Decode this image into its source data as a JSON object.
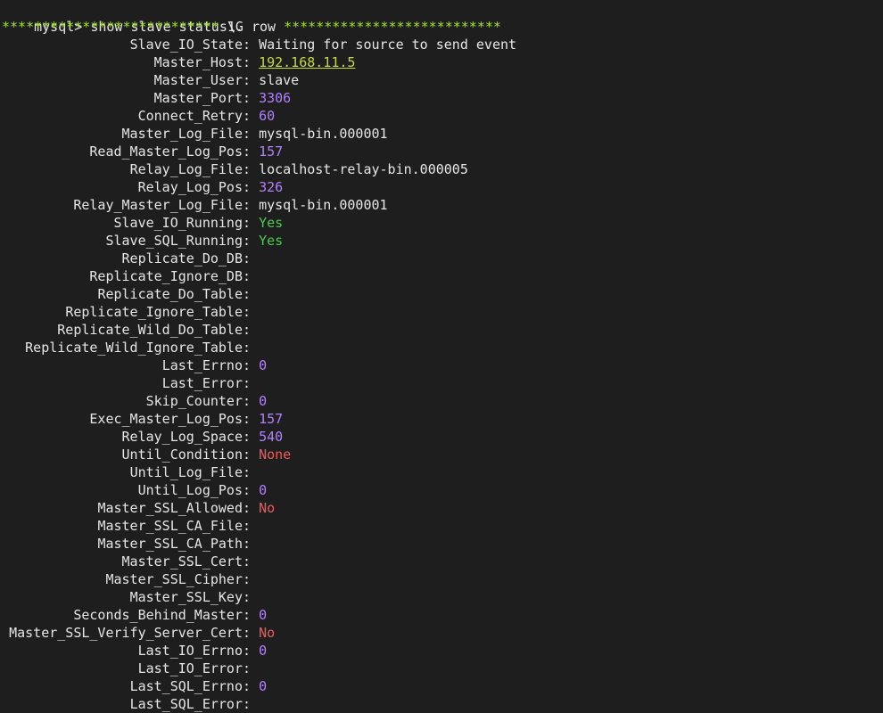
{
  "prompt": {
    "text": "mysql> show slave status\\G"
  },
  "row_header": {
    "stars_left": "***************************",
    "label": " 1. row ",
    "stars_right": "***************************"
  },
  "colors": {
    "number": "#b180ff",
    "ip": "#c5d83a",
    "yes": "#4ec94e",
    "no_none": "#f15a5a",
    "stars": "#a6e22e"
  },
  "fields": [
    {
      "key": "Slave_IO_State",
      "value": "Waiting for source to send event",
      "type": "text"
    },
    {
      "key": "Master_Host",
      "value": "192.168.11.5",
      "type": "ip"
    },
    {
      "key": "Master_User",
      "value": "slave",
      "type": "text"
    },
    {
      "key": "Master_Port",
      "value": "3306",
      "type": "num"
    },
    {
      "key": "Connect_Retry",
      "value": "60",
      "type": "num"
    },
    {
      "key": "Master_Log_File",
      "value": "mysql-bin.000001",
      "type": "text"
    },
    {
      "key": "Read_Master_Log_Pos",
      "value": "157",
      "type": "num"
    },
    {
      "key": "Relay_Log_File",
      "value": "localhost-relay-bin.000005",
      "type": "text"
    },
    {
      "key": "Relay_Log_Pos",
      "value": "326",
      "type": "num"
    },
    {
      "key": "Relay_Master_Log_File",
      "value": "mysql-bin.000001",
      "type": "text"
    },
    {
      "key": "Slave_IO_Running",
      "value": "Yes",
      "type": "yes"
    },
    {
      "key": "Slave_SQL_Running",
      "value": "Yes",
      "type": "yes"
    },
    {
      "key": "Replicate_Do_DB",
      "value": "",
      "type": "text"
    },
    {
      "key": "Replicate_Ignore_DB",
      "value": "",
      "type": "text"
    },
    {
      "key": "Replicate_Do_Table",
      "value": "",
      "type": "text"
    },
    {
      "key": "Replicate_Ignore_Table",
      "value": "",
      "type": "text"
    },
    {
      "key": "Replicate_Wild_Do_Table",
      "value": "",
      "type": "text"
    },
    {
      "key": "Replicate_Wild_Ignore_Table",
      "value": "",
      "type": "text"
    },
    {
      "key": "Last_Errno",
      "value": "0",
      "type": "num"
    },
    {
      "key": "Last_Error",
      "value": "",
      "type": "text"
    },
    {
      "key": "Skip_Counter",
      "value": "0",
      "type": "num"
    },
    {
      "key": "Exec_Master_Log_Pos",
      "value": "157",
      "type": "num"
    },
    {
      "key": "Relay_Log_Space",
      "value": "540",
      "type": "num"
    },
    {
      "key": "Until_Condition",
      "value": "None",
      "type": "red"
    },
    {
      "key": "Until_Log_File",
      "value": "",
      "type": "text"
    },
    {
      "key": "Until_Log_Pos",
      "value": "0",
      "type": "num"
    },
    {
      "key": "Master_SSL_Allowed",
      "value": "No",
      "type": "red"
    },
    {
      "key": "Master_SSL_CA_File",
      "value": "",
      "type": "text"
    },
    {
      "key": "Master_SSL_CA_Path",
      "value": "",
      "type": "text"
    },
    {
      "key": "Master_SSL_Cert",
      "value": "",
      "type": "text"
    },
    {
      "key": "Master_SSL_Cipher",
      "value": "",
      "type": "text"
    },
    {
      "key": "Master_SSL_Key",
      "value": "",
      "type": "text"
    },
    {
      "key": "Seconds_Behind_Master",
      "value": "0",
      "type": "num"
    },
    {
      "key": "Master_SSL_Verify_Server_Cert",
      "value": "No",
      "type": "red"
    },
    {
      "key": "Last_IO_Errno",
      "value": "0",
      "type": "num"
    },
    {
      "key": "Last_IO_Error",
      "value": "",
      "type": "text"
    },
    {
      "key": "Last_SQL_Errno",
      "value": "0",
      "type": "num"
    },
    {
      "key": "Last_SQL_Error",
      "value": "",
      "type": "text"
    }
  ]
}
